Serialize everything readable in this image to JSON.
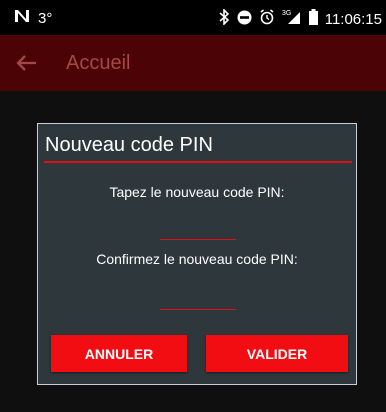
{
  "status_bar": {
    "temperature": "3°",
    "network": "3G",
    "time": "11:06:15"
  },
  "app_bar": {
    "title": "Accueil"
  },
  "dialog": {
    "title": "Nouveau code PIN",
    "new_pin_label": "Tapez le nouveau code PIN:",
    "new_pin_value": "",
    "confirm_pin_label": "Confirmez le nouveau code PIN:",
    "confirm_pin_value": "",
    "cancel_label": "ANNULER",
    "confirm_label": "VALIDER"
  },
  "colors": {
    "accent": "#e10f16",
    "app_bar": "#4c0306",
    "dialog_bg": "#2e373c"
  }
}
